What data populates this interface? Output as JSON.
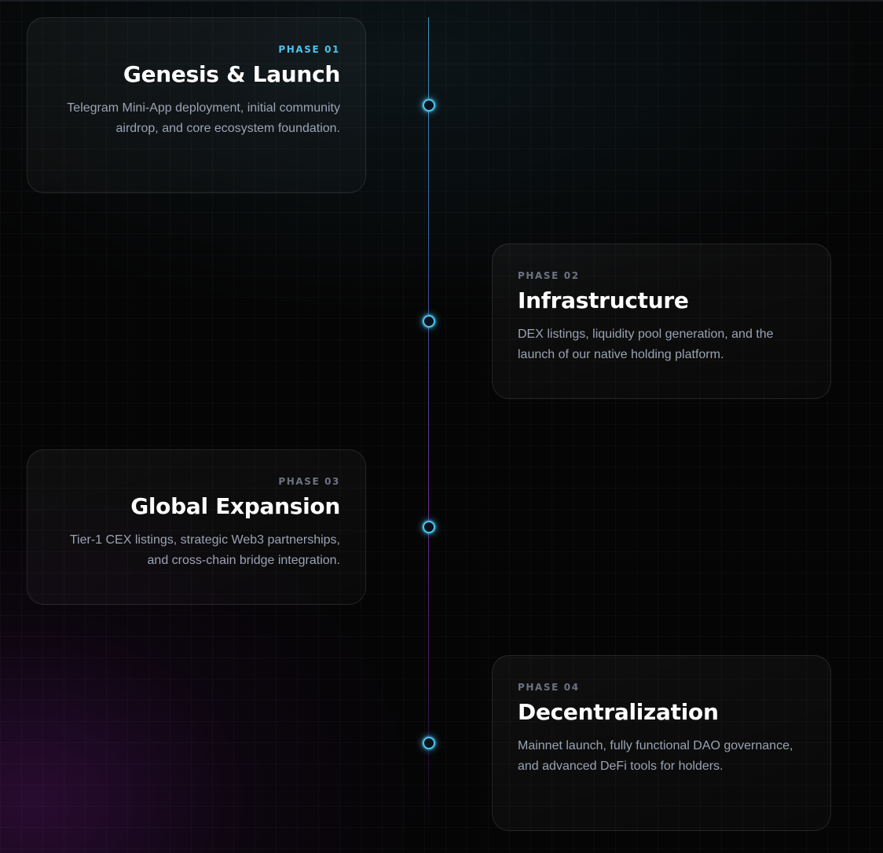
{
  "roadmap": {
    "phases": [
      {
        "label": "PHASE 01",
        "title": "Genesis & Launch",
        "description": "Telegram Mini-App deployment, initial community airdrop, and core ecosystem foundation.",
        "active": true
      },
      {
        "label": "PHASE 02",
        "title": "Infrastructure",
        "description": "DEX listings, liquidity pool generation, and the launch of our native holding platform.",
        "active": false
      },
      {
        "label": "PHASE 03",
        "title": "Global Expansion",
        "description": "Tier-1 CEX listings, strategic Web3 partnerships, and cross-chain bridge integration.",
        "active": false
      },
      {
        "label": "PHASE 04",
        "title": "Decentralization",
        "description": "Mainnet launch, fully functional DAO governance, and advanced DeFi tools for holders.",
        "active": false
      }
    ]
  },
  "colors": {
    "accent": "#4cc3ee",
    "muted_label": "#6b7382",
    "body_text": "#9aa3b4",
    "background": "#050505"
  }
}
